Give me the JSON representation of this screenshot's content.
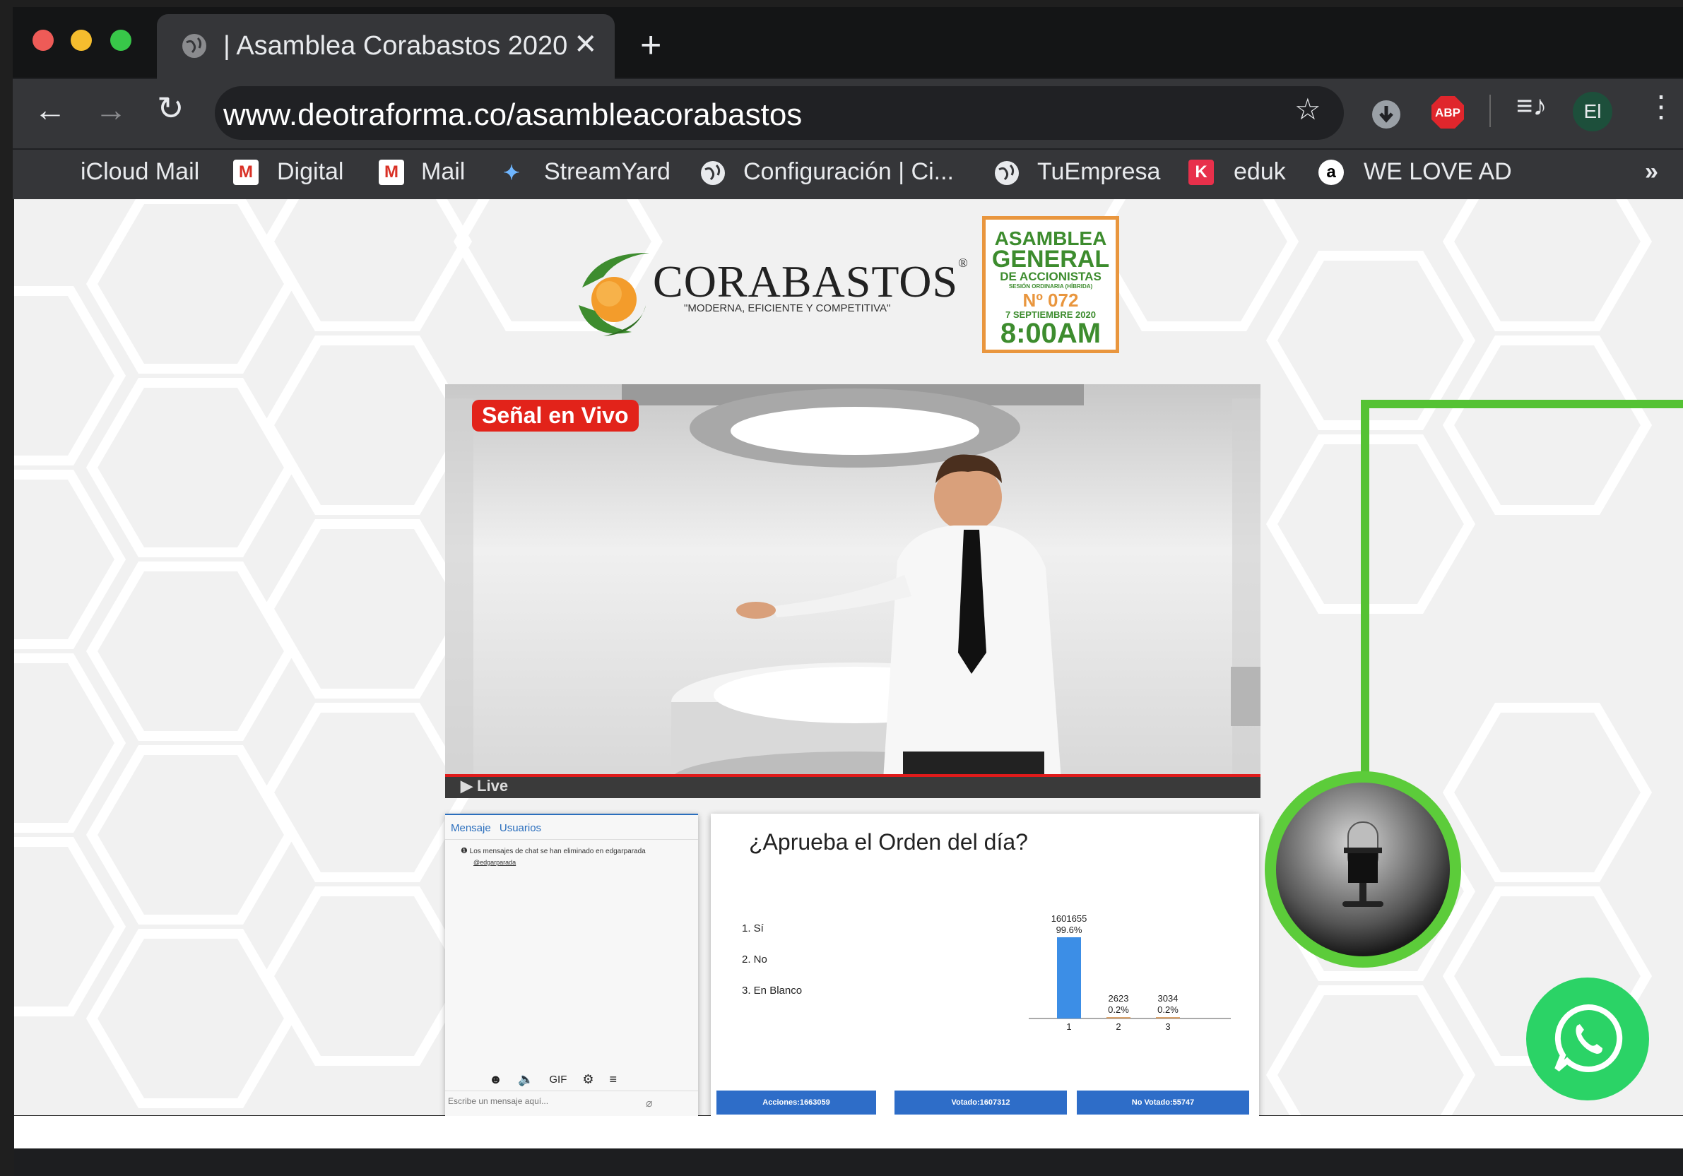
{
  "browser": {
    "tab_title": "| Asamblea Corabastos 2020",
    "url": "www.deotraforma.co/asambleacorabastos",
    "profile_initials": "El",
    "abp_label": "ABP",
    "bookmarks": [
      {
        "label": "iCloud Mail",
        "icon": "apple-icon"
      },
      {
        "label": "Digital",
        "icon": "gmail-icon"
      },
      {
        "label": "Mail",
        "icon": "gmail-icon"
      },
      {
        "label": "StreamYard",
        "icon": "streamyard-icon"
      },
      {
        "label": "Configuración | Ci...",
        "icon": "globe-icon"
      },
      {
        "label": "TuEmpresa",
        "icon": "globe-icon"
      },
      {
        "label": "eduk",
        "icon": "eduk-icon"
      },
      {
        "label": "WE LOVE AD",
        "icon": "amazon-icon"
      }
    ],
    "overflow": "»"
  },
  "header": {
    "brand": "CORABASTOS",
    "registered": "®",
    "slogan": "\"MODERNA, EFICIENTE Y COMPETITIVA\"",
    "badge": {
      "line1": "ASAMBLEA",
      "line2": "GENERAL",
      "line3": "DE ACCIONISTAS",
      "line4": "SESIÓN ORDINARIA (HÍBRIDA)",
      "line5": "Nº 072",
      "line6": "7 SEPTIEMBRE 2020",
      "line7": "8:00AM"
    }
  },
  "video": {
    "live_badge": "Señal en Vivo",
    "live_label": "▶ Live"
  },
  "chat": {
    "tab_messages": "Mensaje",
    "tab_users": "Usuarios",
    "notice": "Los mensajes de chat se han eliminado en edgarparada",
    "notice_user": "@edgarparada",
    "gif_label": "GIF",
    "input_placeholder": "Escribe un mensaje aquí..."
  },
  "poll": {
    "question": "¿Aprueba el Orden del día?",
    "options": [
      "1.  Sí",
      "2.  No",
      "3.  En Blanco"
    ],
    "buttons": [
      "Acciones:1663059",
      "Votado:1607312",
      "No Votado:55747"
    ]
  },
  "chart_data": {
    "type": "bar",
    "categories": [
      "1",
      "2",
      "3"
    ],
    "values": [
      1601655,
      2623,
      3034
    ],
    "labels": [
      "99.6%",
      "0.2%",
      "0.2%"
    ],
    "colors": [
      "#3c8ee6",
      "#d9a26b",
      "#d9a26b"
    ]
  },
  "colors": {
    "accent_green": "#55c234",
    "live_red": "#e2231a",
    "whatsapp": "#2bd366"
  }
}
